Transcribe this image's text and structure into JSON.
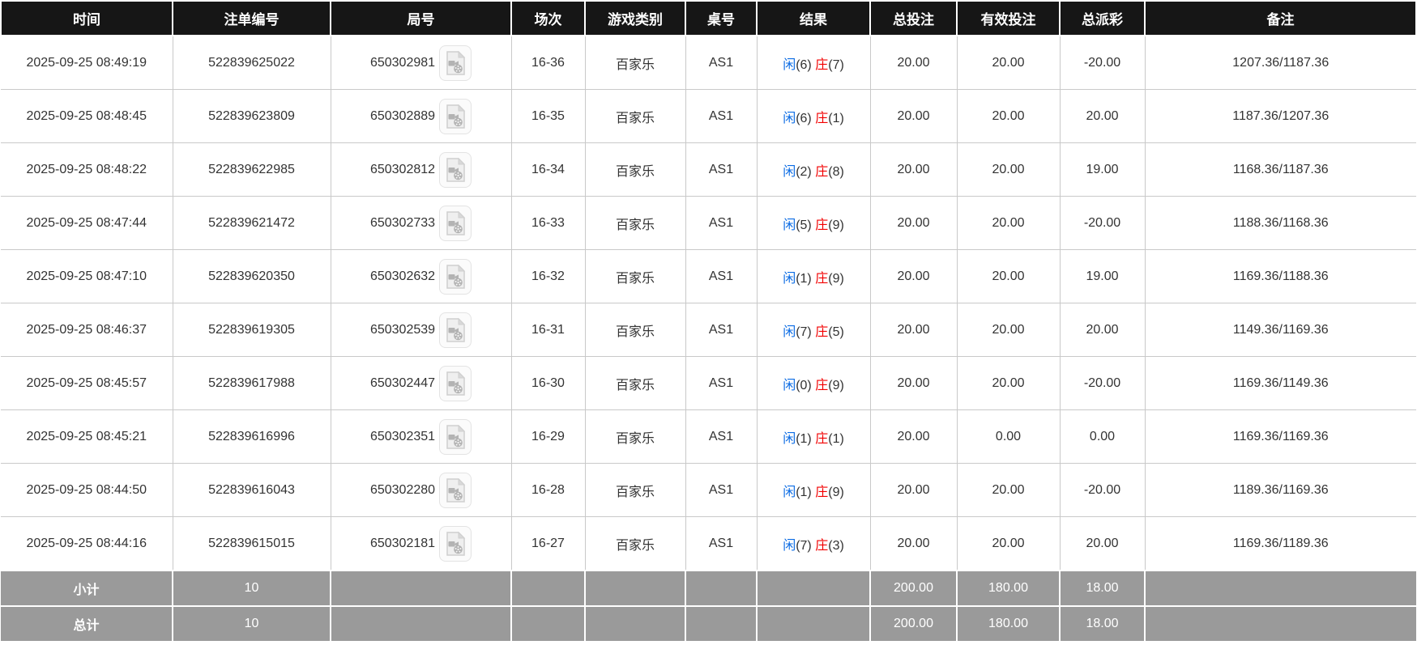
{
  "table": {
    "columns": [
      {
        "key": "time",
        "label": "时间"
      },
      {
        "key": "bet_id",
        "label": "注单编号"
      },
      {
        "key": "round",
        "label": "局号"
      },
      {
        "key": "session",
        "label": "场次"
      },
      {
        "key": "game_type",
        "label": "游戏类别"
      },
      {
        "key": "table_no",
        "label": "桌号"
      },
      {
        "key": "result",
        "label": "结果"
      },
      {
        "key": "total_bet",
        "label": "总投注"
      },
      {
        "key": "valid_bet",
        "label": "有效投注"
      },
      {
        "key": "payout",
        "label": "总派彩"
      },
      {
        "key": "remark",
        "label": "备注"
      }
    ],
    "rows": [
      {
        "time": "2025-09-25 08:49:19",
        "bet_id": "522839625022",
        "round": "650302981",
        "session": "16-36",
        "game_type": "百家乐",
        "table_no": "AS1",
        "result": {
          "player_label": "闲",
          "player_score": "(6)",
          "banker_label": "庄",
          "banker_score": "(7)"
        },
        "total_bet": "20.00",
        "valid_bet": "20.00",
        "payout": "-20.00",
        "payout_negative": true,
        "remark": "1207.36/1187.36"
      },
      {
        "time": "2025-09-25 08:48:45",
        "bet_id": "522839623809",
        "round": "650302889",
        "session": "16-35",
        "game_type": "百家乐",
        "table_no": "AS1",
        "result": {
          "player_label": "闲",
          "player_score": "(6)",
          "banker_label": "庄",
          "banker_score": "(1)"
        },
        "total_bet": "20.00",
        "valid_bet": "20.00",
        "payout": "20.00",
        "payout_negative": false,
        "remark": "1187.36/1207.36"
      },
      {
        "time": "2025-09-25 08:48:22",
        "bet_id": "522839622985",
        "round": "650302812",
        "session": "16-34",
        "game_type": "百家乐",
        "table_no": "AS1",
        "result": {
          "player_label": "闲",
          "player_score": "(2)",
          "banker_label": "庄",
          "banker_score": "(8)"
        },
        "total_bet": "20.00",
        "valid_bet": "20.00",
        "payout": "19.00",
        "payout_negative": false,
        "remark": "1168.36/1187.36"
      },
      {
        "time": "2025-09-25 08:47:44",
        "bet_id": "522839621472",
        "round": "650302733",
        "session": "16-33",
        "game_type": "百家乐",
        "table_no": "AS1",
        "result": {
          "player_label": "闲",
          "player_score": "(5)",
          "banker_label": "庄",
          "banker_score": "(9)"
        },
        "total_bet": "20.00",
        "valid_bet": "20.00",
        "payout": "-20.00",
        "payout_negative": true,
        "remark": "1188.36/1168.36"
      },
      {
        "time": "2025-09-25 08:47:10",
        "bet_id": "522839620350",
        "round": "650302632",
        "session": "16-32",
        "game_type": "百家乐",
        "table_no": "AS1",
        "result": {
          "player_label": "闲",
          "player_score": "(1)",
          "banker_label": "庄",
          "banker_score": "(9)"
        },
        "total_bet": "20.00",
        "valid_bet": "20.00",
        "payout": "19.00",
        "payout_negative": false,
        "remark": "1169.36/1188.36"
      },
      {
        "time": "2025-09-25 08:46:37",
        "bet_id": "522839619305",
        "round": "650302539",
        "session": "16-31",
        "game_type": "百家乐",
        "table_no": "AS1",
        "result": {
          "player_label": "闲",
          "player_score": "(7)",
          "banker_label": "庄",
          "banker_score": "(5)"
        },
        "total_bet": "20.00",
        "valid_bet": "20.00",
        "payout": "20.00",
        "payout_negative": false,
        "remark": "1149.36/1169.36"
      },
      {
        "time": "2025-09-25 08:45:57",
        "bet_id": "522839617988",
        "round": "650302447",
        "session": "16-30",
        "game_type": "百家乐",
        "table_no": "AS1",
        "result": {
          "player_label": "闲",
          "player_score": "(0)",
          "banker_label": "庄",
          "banker_score": "(9)"
        },
        "total_bet": "20.00",
        "valid_bet": "20.00",
        "payout": "-20.00",
        "payout_negative": true,
        "remark": "1169.36/1149.36"
      },
      {
        "time": "2025-09-25 08:45:21",
        "bet_id": "522839616996",
        "round": "650302351",
        "session": "16-29",
        "game_type": "百家乐",
        "table_no": "AS1",
        "result": {
          "player_label": "闲",
          "player_score": "(1)",
          "banker_label": "庄",
          "banker_score": "(1)"
        },
        "total_bet": "20.00",
        "valid_bet": "0.00",
        "payout": "0.00",
        "payout_negative": false,
        "remark": "1169.36/1169.36"
      },
      {
        "time": "2025-09-25 08:44:50",
        "bet_id": "522839616043",
        "round": "650302280",
        "session": "16-28",
        "game_type": "百家乐",
        "table_no": "AS1",
        "result": {
          "player_label": "闲",
          "player_score": "(1)",
          "banker_label": "庄",
          "banker_score": "(9)"
        },
        "total_bet": "20.00",
        "valid_bet": "20.00",
        "payout": "-20.00",
        "payout_negative": true,
        "remark": "1189.36/1169.36"
      },
      {
        "time": "2025-09-25 08:44:16",
        "bet_id": "522839615015",
        "round": "650302181",
        "session": "16-27",
        "game_type": "百家乐",
        "table_no": "AS1",
        "result": {
          "player_label": "闲",
          "player_score": "(7)",
          "banker_label": "庄",
          "banker_score": "(3)"
        },
        "total_bet": "20.00",
        "valid_bet": "20.00",
        "payout": "20.00",
        "payout_negative": false,
        "remark": "1169.36/1189.36"
      }
    ],
    "summary": [
      {
        "key": "subtotal",
        "label": "小计",
        "count": "10",
        "total_bet": "200.00",
        "valid_bet": "180.00",
        "payout": "18.00"
      },
      {
        "key": "total",
        "label": "总计",
        "count": "10",
        "total_bet": "200.00",
        "valid_bet": "180.00",
        "payout": "18.00"
      }
    ],
    "icons": {
      "video_replay": "video-replay-icon"
    },
    "colors": {
      "header_bg": "#161616",
      "header_text": "#ffffff",
      "footer_bg": "#9a9a9a",
      "player_blue": "#0c6ce4",
      "banker_red": "#f20000",
      "negative_red": "#ff0000",
      "bet_blue": "#0c6ce4",
      "body_text": "#333333"
    }
  }
}
